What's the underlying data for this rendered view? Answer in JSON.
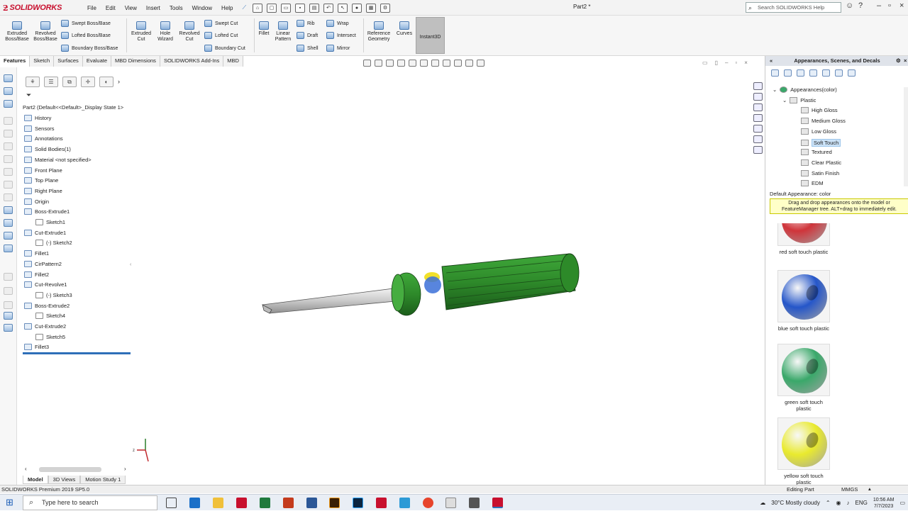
{
  "app": {
    "logo_text": "SOLIDWORKS",
    "doc_title": "Part2 *",
    "search_placeholder": "Search SOLIDWORKS Help"
  },
  "menu": [
    "File",
    "Edit",
    "View",
    "Insert",
    "Tools",
    "Window",
    "Help"
  ],
  "ribbon": {
    "extruded_boss": "Extruded Boss/Base",
    "revolved_boss": "Revolved Boss/Base",
    "swept_boss": "Swept Boss/Base",
    "lofted_boss": "Lofted Boss/Base",
    "boundary_boss": "Boundary Boss/Base",
    "extruded_cut": "Extruded Cut",
    "hole_wizard": "Hole Wizard",
    "revolved_cut": "Revolved Cut",
    "swept_cut": "Swept Cut",
    "lofted_cut": "Lofted Cut",
    "boundary_cut": "Boundary Cut",
    "fillet": "Fillet",
    "linear_pattern": "Linear Pattern",
    "rib": "Rib",
    "draft": "Draft",
    "shell": "Shell",
    "wrap": "Wrap",
    "intersect": "Intersect",
    "mirror": "Mirror",
    "reference_geometry": "Reference Geometry",
    "curves": "Curves",
    "instant3d": "Instant3D"
  },
  "cm_tabs": [
    "Features",
    "Sketch",
    "Surfaces",
    "Evaluate",
    "MBD Dimensions",
    "SOLIDWORKS Add-Ins",
    "MBD"
  ],
  "feature_tree": {
    "root": "Part2  (Default<<Default>_Display State 1>",
    "items": [
      {
        "label": "History",
        "indent": 0
      },
      {
        "label": "Sensors",
        "indent": 0
      },
      {
        "label": "Annotations",
        "indent": 0
      },
      {
        "label": "Solid Bodies(1)",
        "indent": 0
      },
      {
        "label": "Material <not specified>",
        "indent": 0
      },
      {
        "label": "Front Plane",
        "indent": 0
      },
      {
        "label": "Top Plane",
        "indent": 0
      },
      {
        "label": "Right Plane",
        "indent": 0
      },
      {
        "label": "Origin",
        "indent": 0
      },
      {
        "label": "Boss-Extrude1",
        "indent": 0
      },
      {
        "label": "Sketch1",
        "indent": 1
      },
      {
        "label": "Cut-Extrude1",
        "indent": 0
      },
      {
        "label": "(-) Sketch2",
        "indent": 1
      },
      {
        "label": "Fillet1",
        "indent": 0
      },
      {
        "label": "CirPattern2",
        "indent": 0
      },
      {
        "label": "Fillet2",
        "indent": 0
      },
      {
        "label": "Cut-Revolve1",
        "indent": 0
      },
      {
        "label": "(-) Sketch3",
        "indent": 1
      },
      {
        "label": "Boss-Extrude2",
        "indent": 0
      },
      {
        "label": "Sketch4",
        "indent": 1
      },
      {
        "label": "Cut-Extrude2",
        "indent": 0
      },
      {
        "label": "Sketch5",
        "indent": 1
      },
      {
        "label": "Fillet3",
        "indent": 0
      }
    ]
  },
  "bottom_tabs": [
    "Model",
    "3D Views",
    "Motion Study 1"
  ],
  "status": {
    "product": "SOLIDWORKS Premium 2019 SP5.0",
    "mode": "Editing Part",
    "units": "MMGS"
  },
  "right_panel": {
    "title": "Appearances, Scenes, and Decals",
    "tree": [
      {
        "label": "Appearances(color)",
        "level": 0
      },
      {
        "label": "Plastic",
        "level": 1
      },
      {
        "label": "High Gloss",
        "level": 2
      },
      {
        "label": "Medium Gloss",
        "level": 2
      },
      {
        "label": "Low Gloss",
        "level": 2
      },
      {
        "label": "Soft Touch",
        "level": 2,
        "selected": true
      },
      {
        "label": "Textured",
        "level": 2
      },
      {
        "label": "Clear Plastic",
        "level": 2
      },
      {
        "label": "Satin Finish",
        "level": 2
      },
      {
        "label": "EDM",
        "level": 2
      }
    ],
    "default_appearance": "Default Appearance: color",
    "tip": "Drag and drop appearances onto the model or FeatureManager tree.  ALT+drag to immediately edit.",
    "swatches": [
      {
        "label": "red soft touch plastic",
        "color": "#d0343a"
      },
      {
        "label": "blue soft touch plastic",
        "color": "#2556c9"
      },
      {
        "label": "green soft touch plastic",
        "color": "#3aa86a"
      },
      {
        "label": "yellow soft touch plastic",
        "color": "#e9ea2e"
      }
    ]
  },
  "taskbar": {
    "search_placeholder": "Type here to search",
    "weather": "30°C  Mostly cloudy",
    "lang": "ENG",
    "time": "10:56 AM",
    "date": "7/7/2023"
  },
  "colors": {
    "handle_green": "#2e8a2a",
    "accent_blue": "#2e6fb8"
  }
}
